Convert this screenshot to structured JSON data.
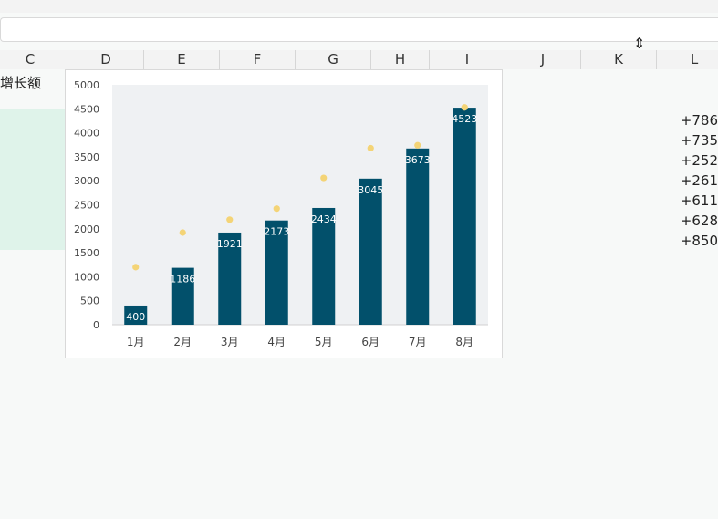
{
  "formula_bar": {
    "value": ""
  },
  "columns": [
    "C",
    "D",
    "E",
    "F",
    "G",
    "H",
    "I",
    "J",
    "K",
    "L"
  ],
  "sheet": {
    "header_cell": "增长额",
    "deltas": [
      "+786",
      "+735",
      "+252",
      "+261",
      "+611",
      "+628",
      "+850"
    ]
  },
  "chart_data": {
    "type": "bar",
    "categories": [
      "1月",
      "2月",
      "3月",
      "4月",
      "5月",
      "6月",
      "7月",
      "8月"
    ],
    "series": [
      {
        "values": [
          400,
          1186,
          1921,
          2173,
          2434,
          3045,
          3673,
          4523
        ]
      },
      {
        "type": "scatter",
        "values": [
          1200,
          1920,
          2190,
          2420,
          3060,
          3680,
          3740,
          4530
        ]
      }
    ],
    "ylim": [
      0,
      5000
    ],
    "yticks": [
      "0",
      "500",
      "1000",
      "1500",
      "2000",
      "2500",
      "3000",
      "3500",
      "4000",
      "4500",
      "5000"
    ],
    "colors": {
      "bar": "#02506b",
      "dot": "#f4d476",
      "plot_bg": "#eff1f3",
      "label": "#ffffff"
    }
  }
}
